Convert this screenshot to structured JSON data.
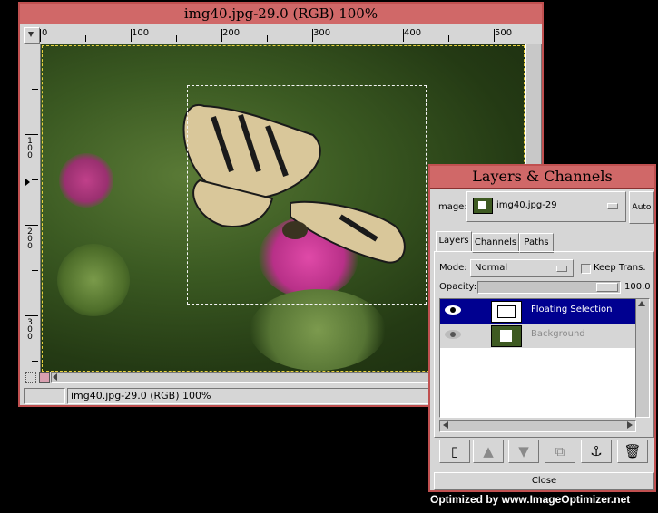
{
  "image_window": {
    "title": "img40.jpg-29.0 (RGB) 100%",
    "ruler_labels": [
      "0",
      "100",
      "200",
      "300",
      "400",
      "500"
    ],
    "vruler_labels": [
      "1\n0\n0",
      "2\n0\n0",
      "3\n0\n0"
    ],
    "status": "img40.jpg-29.0 (RGB) 100%"
  },
  "layers_dialog": {
    "title": "Layers & Channels",
    "image_label": "Image:",
    "image_value": "img40.jpg-29",
    "auto_label": "Auto",
    "tabs": [
      {
        "label": "Layers",
        "active": true
      },
      {
        "label": "Channels",
        "active": false
      },
      {
        "label": "Paths",
        "active": false
      }
    ],
    "mode_label": "Mode:",
    "mode_value": "Normal",
    "keep_trans_label": "Keep Trans.",
    "keep_trans_checked": false,
    "opacity_label": "Opacity:",
    "opacity_value": "100.0",
    "layers": [
      {
        "name": "Floating Selection",
        "selected": true,
        "visible": true
      },
      {
        "name": "Background",
        "selected": false,
        "visible": true
      }
    ],
    "buttons": [
      {
        "icon": "new-layer-icon",
        "glyph": "▯"
      },
      {
        "icon": "raise-layer-icon",
        "glyph": "▲"
      },
      {
        "icon": "lower-layer-icon",
        "glyph": "▼"
      },
      {
        "icon": "duplicate-layer-icon",
        "glyph": "⧉"
      },
      {
        "icon": "anchor-layer-icon",
        "glyph": "⚓"
      },
      {
        "icon": "delete-layer-icon",
        "glyph": "🗑"
      }
    ],
    "close_label": "Close"
  },
  "watermark": "Optimized by www.ImageOptimizer.net",
  "colors": {
    "title_bar": "#d06868",
    "selection": "#000090",
    "border": "#c05050"
  }
}
